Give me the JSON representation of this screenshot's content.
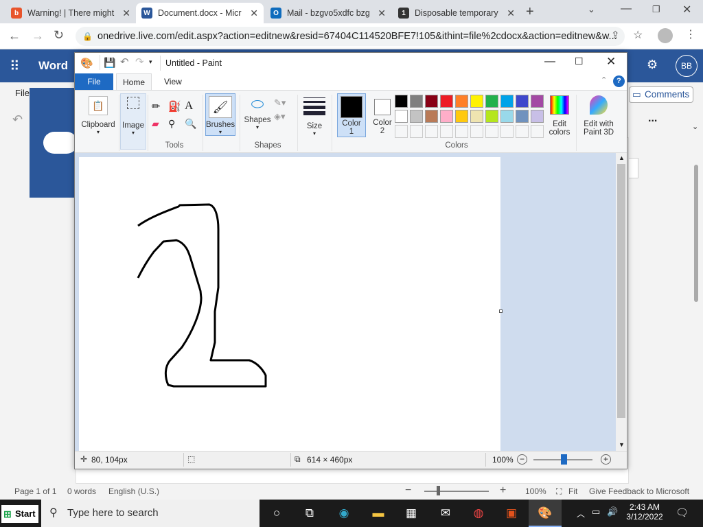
{
  "browser": {
    "tabs": [
      {
        "title": "Warning! | There might",
        "icon": "warning-icon",
        "color": "#e8542b",
        "glyph": "b"
      },
      {
        "title": "Document.docx - Micr",
        "icon": "word-icon",
        "color": "#2b579a",
        "glyph": "W"
      },
      {
        "title": "Mail - bzgvo5xdfc bzg",
        "icon": "outlook-icon",
        "color": "#0f6cbd",
        "glyph": "O"
      },
      {
        "title": "Disposable temporary",
        "icon": "site-icon",
        "color": "#333",
        "glyph": "1"
      }
    ],
    "new_tab": "+",
    "url": "onedrive.live.com/edit.aspx?action=editnew&resid=67404C114520BFE7!105&ithint=file%2cdocx&action=editnew&w..."
  },
  "word": {
    "app": "Word",
    "avatar": "BB",
    "file": "File",
    "comments": "Comments",
    "more": "...",
    "status": {
      "page": "Page 1 of 1",
      "words": "0 words",
      "lang": "English (U.S.)",
      "zoom": "100%",
      "fit": "Fit",
      "feedback": "Give Feedback to Microsoft"
    }
  },
  "paint": {
    "title": "Untitled - Paint",
    "tabs": {
      "file": "File",
      "home": "Home",
      "view": "View"
    },
    "tools": {
      "clipboard": "Clipboard",
      "image": "Image",
      "tools": "Tools",
      "brushes": "Brushes",
      "shapes": "Shapes",
      "shapes_group": "Shapes",
      "size": "Size",
      "color1": "Color",
      "color1_num": "1",
      "color2": "Color",
      "color2_num": "2",
      "colors": "Colors",
      "edit_colors_1": "Edit",
      "edit_colors_2": "colors",
      "paint3d_1": "Edit with",
      "paint3d_2": "Paint 3D"
    },
    "palette": [
      "#000000",
      "#7f7f7f",
      "#880015",
      "#ed1c24",
      "#ff7f27",
      "#fff200",
      "#22b14c",
      "#00a2e8",
      "#3f48cc",
      "#a349a4",
      "#ffffff",
      "#c3c3c3",
      "#b97a57",
      "#ffaec9",
      "#ffc90e",
      "#efe4b0",
      "#b5e61d",
      "#99d9ea",
      "#7092be",
      "#c8bfe7"
    ],
    "status": {
      "cursor": "80, 104px",
      "size": "614 × 460px",
      "zoom": "100%"
    }
  },
  "taskbar": {
    "start": "Start",
    "search": "Type here to search",
    "time": "2:43 AM",
    "date": "3/12/2022"
  }
}
